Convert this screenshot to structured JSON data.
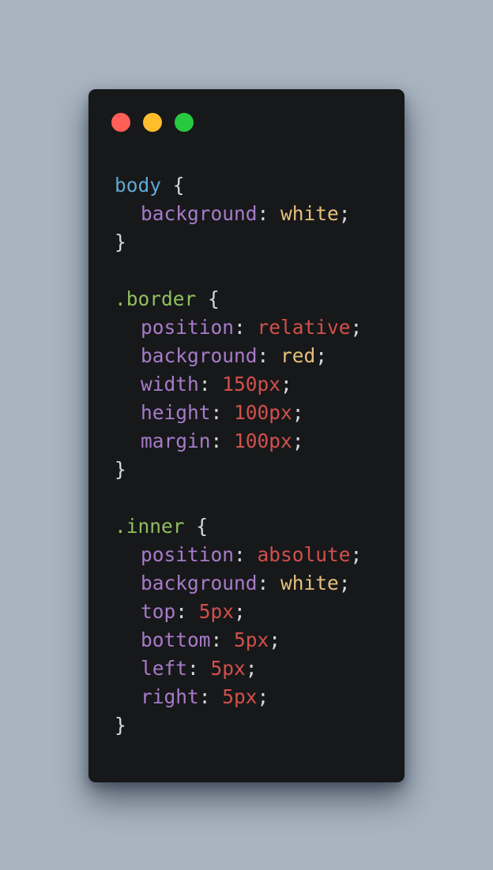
{
  "colors": {
    "background": "#a8b4c0",
    "window": "#17181a",
    "tag": "#5fa8d3",
    "class": "#8fbf5f",
    "property": "#a77bc9",
    "keyword_value": "#e5c07b",
    "numeric_value": "#d2504b",
    "punctuation": "#d6d8dc",
    "dot_red": "#ff5f56",
    "dot_yellow": "#ffbd2e",
    "dot_green": "#27c93f"
  },
  "window_controls": [
    {
      "name": "close",
      "color": "#ff5f56"
    },
    {
      "name": "minimize",
      "color": "#ffbd2e"
    },
    {
      "name": "maximize",
      "color": "#27c93f"
    }
  ],
  "code_lines": [
    {
      "indent": false,
      "tokens": [
        {
          "t": "body",
          "k": "tag"
        },
        {
          "t": " {",
          "k": "punct"
        }
      ]
    },
    {
      "indent": true,
      "tokens": [
        {
          "t": "background",
          "k": "prop"
        },
        {
          "t": ": ",
          "k": "punct"
        },
        {
          "t": "white",
          "k": "kw"
        },
        {
          "t": ";",
          "k": "punct"
        }
      ]
    },
    {
      "indent": false,
      "tokens": [
        {
          "t": "}",
          "k": "punct"
        }
      ]
    },
    {
      "indent": false,
      "tokens": []
    },
    {
      "indent": false,
      "tokens": [
        {
          "t": ".border",
          "k": "class"
        },
        {
          "t": " {",
          "k": "punct"
        }
      ]
    },
    {
      "indent": true,
      "tokens": [
        {
          "t": "position",
          "k": "prop"
        },
        {
          "t": ": ",
          "k": "punct"
        },
        {
          "t": "relative",
          "k": "num"
        },
        {
          "t": ";",
          "k": "punct"
        }
      ]
    },
    {
      "indent": true,
      "tokens": [
        {
          "t": "background",
          "k": "prop"
        },
        {
          "t": ": ",
          "k": "punct"
        },
        {
          "t": "red",
          "k": "kw"
        },
        {
          "t": ";",
          "k": "punct"
        }
      ]
    },
    {
      "indent": true,
      "tokens": [
        {
          "t": "width",
          "k": "prop"
        },
        {
          "t": ": ",
          "k": "punct"
        },
        {
          "t": "150px",
          "k": "num"
        },
        {
          "t": ";",
          "k": "punct"
        }
      ]
    },
    {
      "indent": true,
      "tokens": [
        {
          "t": "height",
          "k": "prop"
        },
        {
          "t": ": ",
          "k": "punct"
        },
        {
          "t": "100px",
          "k": "num"
        },
        {
          "t": ";",
          "k": "punct"
        }
      ]
    },
    {
      "indent": true,
      "tokens": [
        {
          "t": "margin",
          "k": "prop"
        },
        {
          "t": ": ",
          "k": "punct"
        },
        {
          "t": "100px",
          "k": "num"
        },
        {
          "t": ";",
          "k": "punct"
        }
      ]
    },
    {
      "indent": false,
      "tokens": [
        {
          "t": "}",
          "k": "punct"
        }
      ]
    },
    {
      "indent": false,
      "tokens": []
    },
    {
      "indent": false,
      "tokens": [
        {
          "t": ".inner",
          "k": "class"
        },
        {
          "t": " {",
          "k": "punct"
        }
      ]
    },
    {
      "indent": true,
      "tokens": [
        {
          "t": "position",
          "k": "prop"
        },
        {
          "t": ": ",
          "k": "punct"
        },
        {
          "t": "absolute",
          "k": "num"
        },
        {
          "t": ";",
          "k": "punct"
        }
      ]
    },
    {
      "indent": true,
      "tokens": [
        {
          "t": "background",
          "k": "prop"
        },
        {
          "t": ": ",
          "k": "punct"
        },
        {
          "t": "white",
          "k": "kw"
        },
        {
          "t": ";",
          "k": "punct"
        }
      ]
    },
    {
      "indent": true,
      "tokens": [
        {
          "t": "top",
          "k": "prop"
        },
        {
          "t": ": ",
          "k": "punct"
        },
        {
          "t": "5px",
          "k": "num"
        },
        {
          "t": ";",
          "k": "punct"
        }
      ]
    },
    {
      "indent": true,
      "tokens": [
        {
          "t": "bottom",
          "k": "prop"
        },
        {
          "t": ": ",
          "k": "punct"
        },
        {
          "t": "5px",
          "k": "num"
        },
        {
          "t": ";",
          "k": "punct"
        }
      ]
    },
    {
      "indent": true,
      "tokens": [
        {
          "t": "left",
          "k": "prop"
        },
        {
          "t": ": ",
          "k": "punct"
        },
        {
          "t": "5px",
          "k": "num"
        },
        {
          "t": ";",
          "k": "punct"
        }
      ]
    },
    {
      "indent": true,
      "tokens": [
        {
          "t": "right",
          "k": "prop"
        },
        {
          "t": ": ",
          "k": "punct"
        },
        {
          "t": "5px",
          "k": "num"
        },
        {
          "t": ";",
          "k": "punct"
        }
      ]
    },
    {
      "indent": false,
      "tokens": [
        {
          "t": "}",
          "k": "punct"
        }
      ]
    }
  ]
}
